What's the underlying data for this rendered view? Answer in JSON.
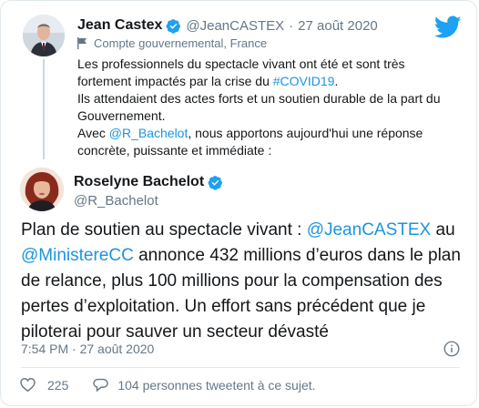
{
  "colors": {
    "link": "#1b95e0",
    "verified": "#1da1f2",
    "text": "#14171a",
    "muted": "#657786"
  },
  "quoted_tweet": {
    "author_name": "Jean Castex",
    "handle": "@JeanCASTEX",
    "separator": "·",
    "date": "27 août 2020",
    "label": "Compte gouvernemental, France",
    "line1": "Les professionnels du spectacle vivant ont été et sont très fortement impactés par la crise du ",
    "hashtag": "#COVID19",
    "line1_end": ".",
    "line2": "Ils attendaient des actes forts et un soutien durable de la part du Gouvernement.",
    "line3_start": "Avec ",
    "mention": "@R_Bachelot",
    "line3_end": ", nous apportons aujourd'hui une réponse concrète, puissante et immédiate :"
  },
  "main_tweet": {
    "author_name": "Roselyne Bachelot",
    "handle": "@R_Bachelot",
    "text_1": "Plan de soutien au spectacle vivant : ",
    "mention_1": "@JeanCASTEX",
    "text_2": " au ",
    "mention_2": "@MinistereCC",
    "text_3": " annonce 432 millions d’euros dans le plan de relance, plus 100 millions pour la compensation des pertes d’exploitation. Un effort sans précédent que je piloterai pour sauver un secteur dévasté",
    "timestamp": "7:54 PM · 27 août 2020"
  },
  "actions": {
    "likes": "225",
    "reply_text": "104 personnes tweetent à ce sujet."
  },
  "icons": [
    "twitter-bird-icon",
    "verified-badge-icon",
    "flag-icon",
    "info-icon",
    "heart-icon",
    "speech-bubble-icon"
  ]
}
